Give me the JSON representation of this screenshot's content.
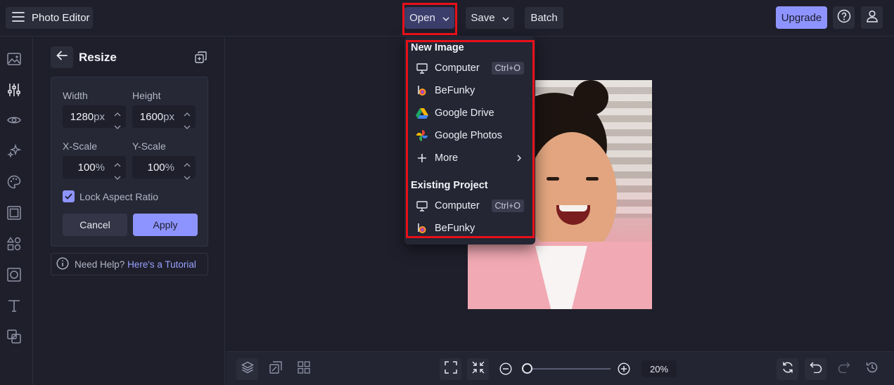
{
  "header": {
    "app_title": "Photo Editor",
    "open_label": "Open",
    "save_label": "Save",
    "batch_label": "Batch",
    "upgrade_label": "Upgrade"
  },
  "sidebar": {
    "icons": [
      "image-icon",
      "sliders-icon",
      "eye-icon",
      "sparkles-icon",
      "palette-icon",
      "frame-icon",
      "shapes-icon",
      "overlay-icon",
      "text-icon",
      "collage-icon"
    ],
    "active_index": 1
  },
  "resize_panel": {
    "title": "Resize",
    "width_label": "Width",
    "height_label": "Height",
    "width_value": "1280",
    "height_value": "1600",
    "unit": "px",
    "xscale_label": "X-Scale",
    "yscale_label": "Y-Scale",
    "xscale_value": "100",
    "yscale_value": "100",
    "percent": "%",
    "lock_label": "Lock Aspect Ratio",
    "lock_checked": true,
    "cancel_label": "Cancel",
    "apply_label": "Apply",
    "help_text": "Need Help?",
    "help_link": "Here's a Tutorial"
  },
  "open_menu": {
    "new_heading": "New Image",
    "new_items": [
      {
        "label": "Computer",
        "shortcut": "Ctrl+O",
        "icon": "monitor-icon"
      },
      {
        "label": "BeFunky",
        "icon": "befunky-icon"
      },
      {
        "label": "Google Drive",
        "icon": "google-drive-icon"
      },
      {
        "label": "Google Photos",
        "icon": "google-photos-icon"
      },
      {
        "label": "More",
        "icon": "plus-icon"
      }
    ],
    "existing_heading": "Existing Project",
    "existing_items": [
      {
        "label": "Computer",
        "shortcut": "Ctrl+O",
        "icon": "monitor-icon"
      },
      {
        "label": "BeFunky",
        "icon": "befunky-icon"
      }
    ]
  },
  "bottom_bar": {
    "zoom_label": "20%",
    "zoom_level": 0.05
  },
  "colors": {
    "accent": "#8e94ff",
    "background": "#1e1f2b",
    "highlight": "#e8101a"
  }
}
